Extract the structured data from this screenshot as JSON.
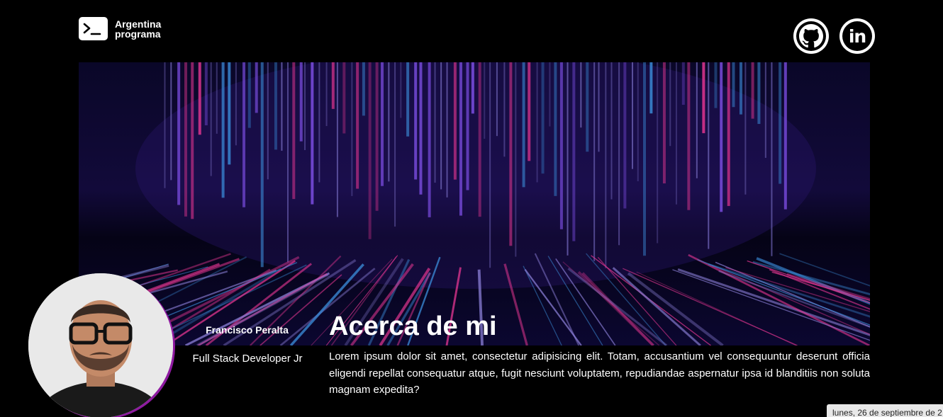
{
  "header": {
    "logo_line1": "Argentina",
    "logo_line2": "programa",
    "logo_icon": "terminal-icon",
    "social": [
      {
        "name": "github",
        "icon": "github-icon"
      },
      {
        "name": "linkedin",
        "icon": "linkedin-icon",
        "glyph": "in"
      }
    ]
  },
  "banner": {
    "theme": "binary-code-rain",
    "colors": [
      "#e0358f",
      "#3a8ad6",
      "#7b4de0",
      "#1b1150"
    ]
  },
  "profile": {
    "name": "Francisco Peralta",
    "role": "Full Stack Developer Jr",
    "accent": "#8e1aa0"
  },
  "about": {
    "title": "Acerca de mi",
    "text": "Lorem ipsum dolor sit amet, consectetur adipisicing elit. Totam, accusantium vel consequuntur deserunt officia eligendi repellat consequatur atque, fugit nesciunt voluptatem, repudiandae aspernatur ipsa id blanditiis non soluta magnam expedita?"
  },
  "date_tooltip": "lunes, 26 de septiembre de 2"
}
